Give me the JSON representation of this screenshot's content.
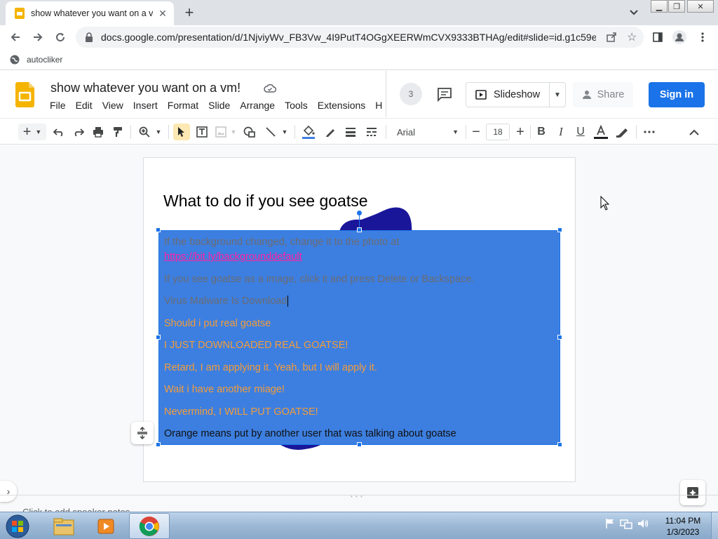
{
  "browser": {
    "tab_title": "show whatever you want on a vm!",
    "url": "docs.google.com/presentation/d/1NjviyWv_FB3Vw_4I9PutT4OGgXEERWmCVX9333BTHAg/edit#slide=id.g1c59e...",
    "bookmark": "autocliker"
  },
  "app": {
    "doc_title": "show whatever you want on a vm!",
    "menu": [
      "File",
      "Edit",
      "View",
      "Insert",
      "Format",
      "Slide",
      "Arrange",
      "Tools",
      "Extensions",
      "H"
    ],
    "viewer_count": "3",
    "slideshow_label": "Slideshow",
    "share_label": "Share",
    "signin_label": "Sign in"
  },
  "toolbar": {
    "font": "Arial",
    "font_size": "18"
  },
  "slide": {
    "title": "What to do if you see goatse",
    "paragraphs": [
      {
        "text": "If the background changed, change it to the photo at",
        "style": "gray"
      },
      {
        "text": "https://bit.ly/backgrounddefault",
        "style": "pink"
      },
      {
        "text": "If you see goatse as a image, click it and press Delete or Backspace.",
        "style": "gray"
      },
      {
        "text": "Virus Malware Is Download",
        "style": "gray"
      },
      {
        "text": "Should i put real goatse",
        "style": "orange"
      },
      {
        "text": "I JUST DOWNLOADED REAL GOATSE!",
        "style": "orange"
      },
      {
        "text": "Retard, I am applying it. Yeah, but I will apply it.",
        "style": "orange"
      },
      {
        "text": "Wait i have another miage!",
        "style": "orange"
      },
      {
        "text": "Nevermind, I WILL PUT GOATSE!",
        "style": "orange"
      },
      {
        "text": "Orange means put by another user that was talking about goatse",
        "style": "black"
      }
    ]
  },
  "notes_placeholder": "Click to add speaker notes",
  "taskbar": {
    "time": "11:04 PM",
    "date": "1/3/2023"
  },
  "colors": {
    "accent": "#1a73e8",
    "textbox_fill": "#3d7fe0",
    "orange_text": "#f39c3a"
  }
}
